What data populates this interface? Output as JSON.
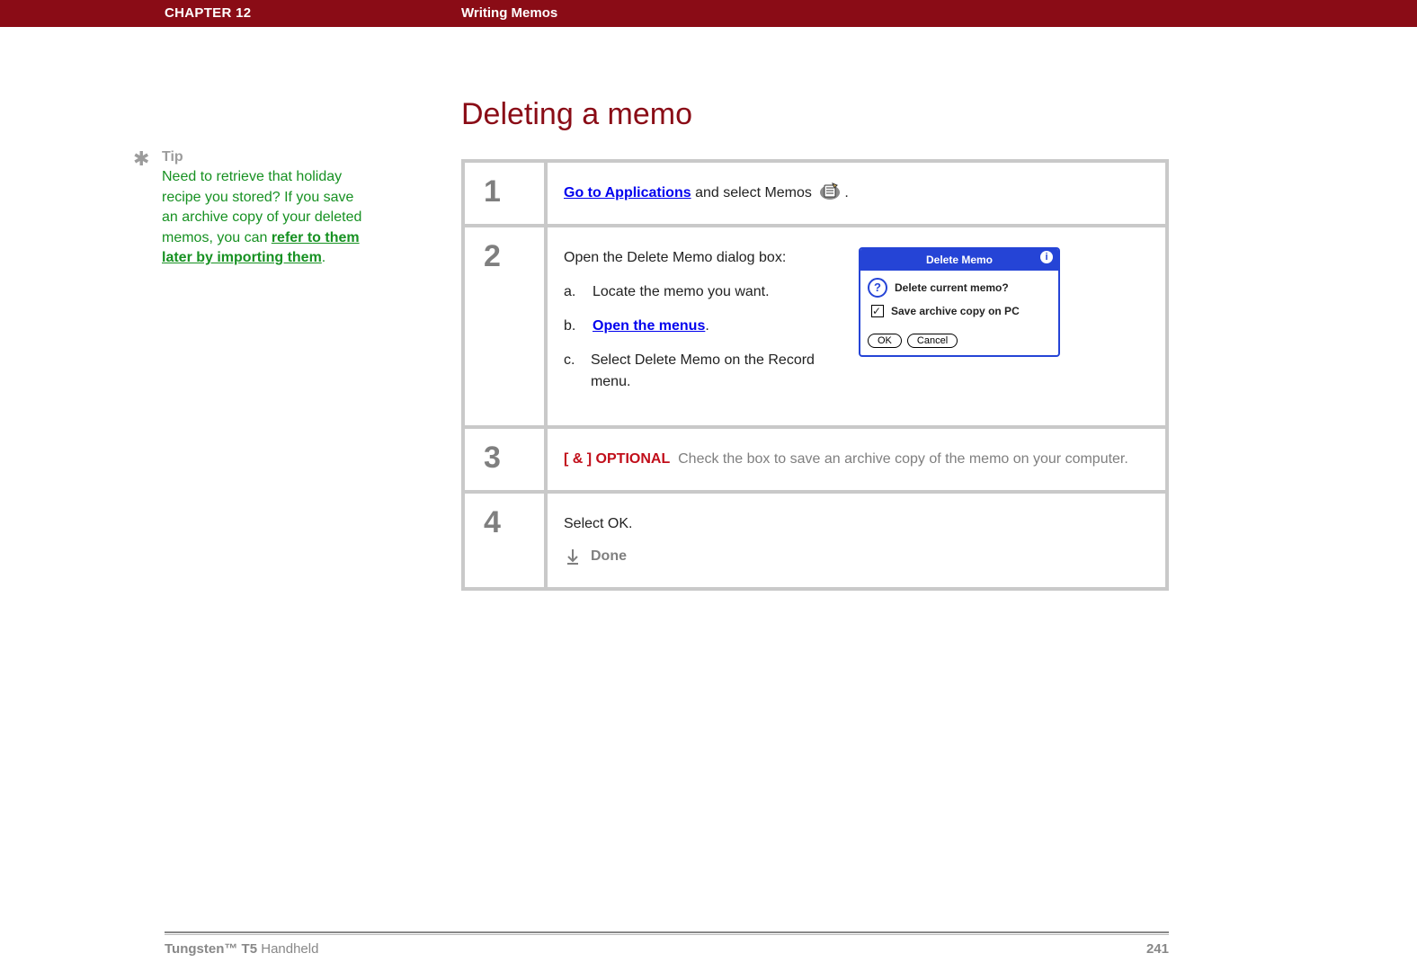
{
  "header": {
    "chapter_label": "CHAPTER 12",
    "section_title": "Writing Memos"
  },
  "page_title": "Deleting a memo",
  "tip": {
    "label": "Tip",
    "text_before_link": "Need to retrieve that holiday recipe you stored? If you save an archive copy of your deleted memos, you can ",
    "link_text": "refer to them later by importing them",
    "text_after_link": "."
  },
  "steps": [
    {
      "num": "1",
      "line_link": "Go to Applications",
      "line_rest": " and select Memos ",
      "line_end": "."
    },
    {
      "num": "2",
      "intro": "Open the Delete Memo dialog box:",
      "subs": [
        {
          "lbl": "a.",
          "text": "Locate the memo you want."
        },
        {
          "lbl": "b.",
          "link": "Open the menus",
          "post": "."
        },
        {
          "lbl": "c.",
          "text": "Select Delete Memo on the Record menu."
        }
      ],
      "dialog": {
        "title": "Delete Memo",
        "question": "Delete current memo?",
        "checkbox_label": "Save archive copy on PC",
        "ok": "OK",
        "cancel": "Cancel"
      }
    },
    {
      "num": "3",
      "optional_tag": "[ & ]  OPTIONAL",
      "text": "Check the box to save an archive copy of the memo on your computer."
    },
    {
      "num": "4",
      "text": "Select OK.",
      "done": "Done"
    }
  ],
  "footer": {
    "product_bold": "Tungsten™ T5",
    "product_rest": " Handheld",
    "page_number": "241"
  }
}
